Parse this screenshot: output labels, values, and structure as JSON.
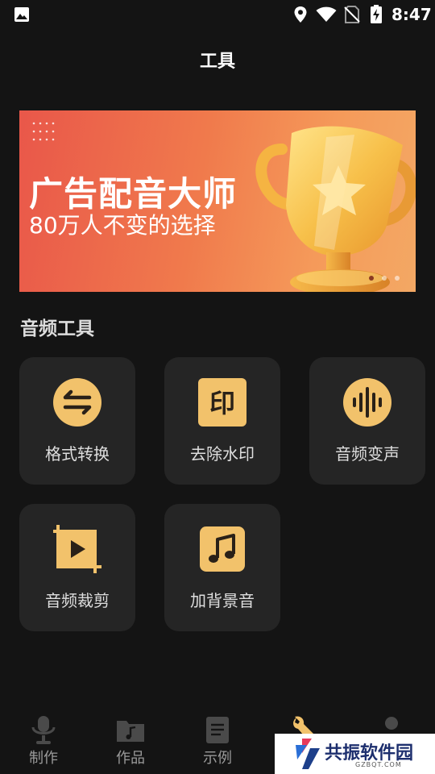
{
  "status_bar": {
    "time": "8:47",
    "icons": [
      "gallery-icon",
      "location-icon",
      "wifi-icon",
      "no-sim-icon",
      "battery-charging-icon"
    ]
  },
  "header": {
    "title": "工具"
  },
  "banner": {
    "title": "广告配音大师",
    "subtitle": "80万人不变的选择",
    "page_count": 3,
    "active_page": 1
  },
  "section": {
    "title": "音频工具"
  },
  "tools": [
    {
      "label": "格式转换",
      "icon": "convert-icon"
    },
    {
      "label": "去除水印",
      "icon": "stamp-icon"
    },
    {
      "label": "音频变声",
      "icon": "voice-wave-icon"
    },
    {
      "label": "音频裁剪",
      "icon": "crop-video-icon"
    },
    {
      "label": "加背景音",
      "icon": "music-note-icon"
    }
  ],
  "colors": {
    "accent": "#f2c26b",
    "accent_dark": "#2a2118",
    "background": "#141414",
    "card": "#252525"
  },
  "bottom_nav": [
    {
      "label": "制作",
      "icon": "microphone-icon"
    },
    {
      "label": "作品",
      "icon": "folder-music-icon"
    },
    {
      "label": "示例",
      "icon": "document-icon"
    },
    {
      "label": "",
      "icon": "wrench-icon"
    },
    {
      "label": "",
      "icon": "user-icon"
    }
  ],
  "watermark": {
    "text": "共振软件园",
    "sub": "GZBQT.COM"
  }
}
